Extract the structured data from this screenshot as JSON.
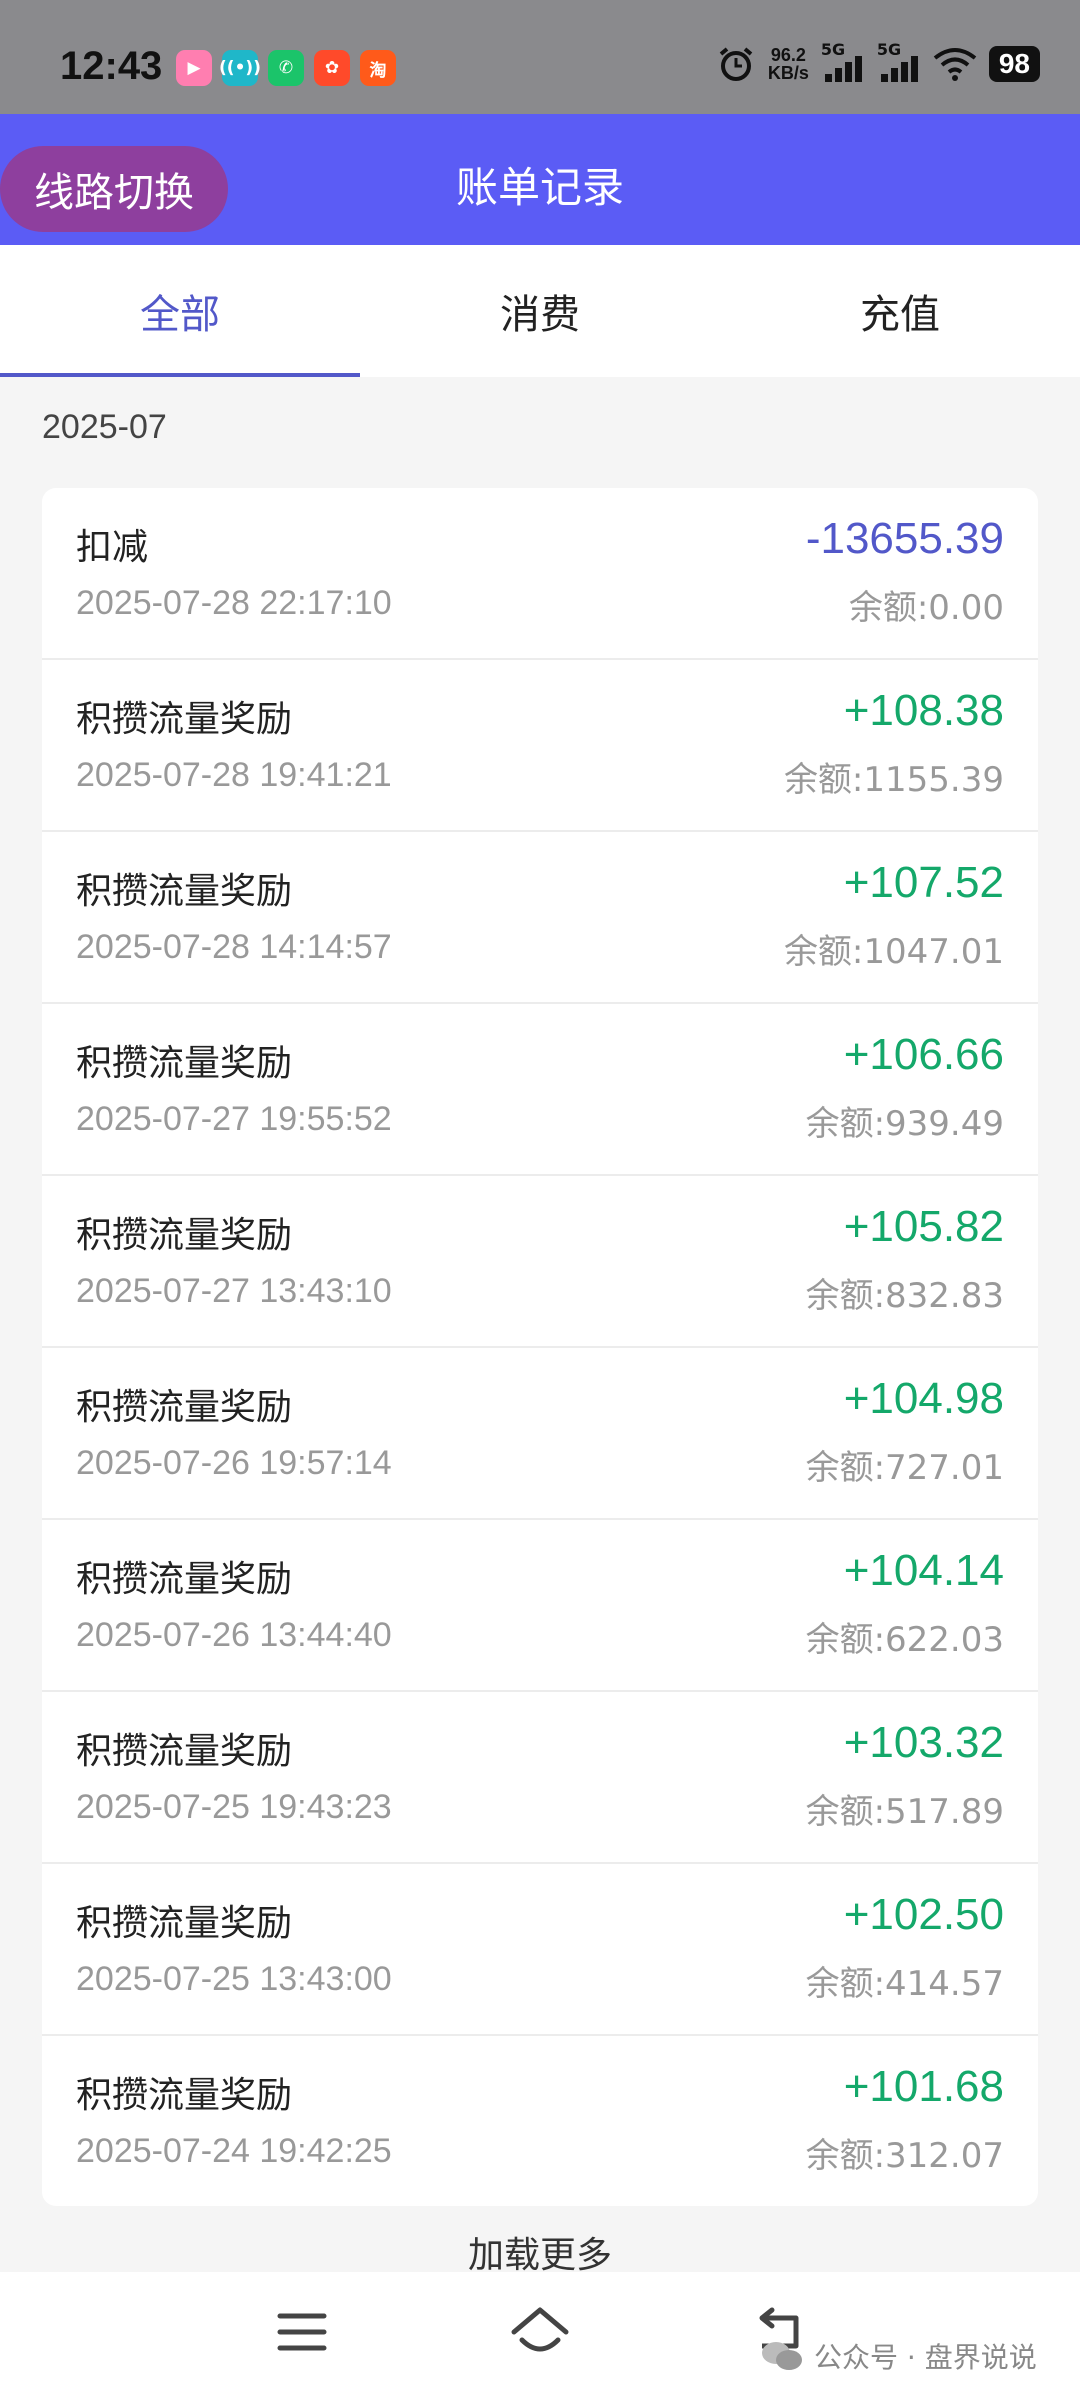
{
  "status_bar": {
    "time": "12:43",
    "net_speed_value": "96.2",
    "net_speed_unit": "KB/s",
    "sim1_label": "5G",
    "sim2_label": "5G",
    "battery": "98"
  },
  "header": {
    "route_button": "线路切换",
    "title": "账单记录"
  },
  "tabs": [
    {
      "label": "全部",
      "active": true
    },
    {
      "label": "消费",
      "active": false
    },
    {
      "label": "充值",
      "active": false
    }
  ],
  "month": "2025-07",
  "transactions": [
    {
      "title": "扣减",
      "time": "2025-07-28 22:17:10",
      "amount": "-13655.39",
      "balance": "余额:0.00"
    },
    {
      "title": "积攒流量奖励",
      "time": "2025-07-28 19:41:21",
      "amount": "+108.38",
      "balance": "余额:1155.39"
    },
    {
      "title": "积攒流量奖励",
      "time": "2025-07-28 14:14:57",
      "amount": "+107.52",
      "balance": "余额:1047.01"
    },
    {
      "title": "积攒流量奖励",
      "time": "2025-07-27 19:55:52",
      "amount": "+106.66",
      "balance": "余额:939.49"
    },
    {
      "title": "积攒流量奖励",
      "time": "2025-07-27 13:43:10",
      "amount": "+105.82",
      "balance": "余额:832.83"
    },
    {
      "title": "积攒流量奖励",
      "time": "2025-07-26 19:57:14",
      "amount": "+104.98",
      "balance": "余额:727.01"
    },
    {
      "title": "积攒流量奖励",
      "time": "2025-07-26 13:44:40",
      "amount": "+104.14",
      "balance": "余额:622.03"
    },
    {
      "title": "积攒流量奖励",
      "time": "2025-07-25 19:43:23",
      "amount": "+103.32",
      "balance": "余额:517.89"
    },
    {
      "title": "积攒流量奖励",
      "time": "2025-07-25 13:43:00",
      "amount": "+102.50",
      "balance": "余额:414.57"
    },
    {
      "title": "积攒流量奖励",
      "time": "2025-07-24 19:42:25",
      "amount": "+101.68",
      "balance": "余额:312.07"
    }
  ],
  "load_more": "加载更多",
  "watermark": "公众号 · 盘界说说",
  "colors": {
    "header_bg": "#5b5cf5",
    "route_button_bg": "#8e3f9e",
    "accent": "#5258c9",
    "positive": "#14a86a"
  },
  "icons": {
    "nav_menu": "menu-icon",
    "nav_home": "home-icon",
    "nav_back": "back-icon",
    "alarm": "alarm-icon",
    "wifi": "wifi-icon"
  }
}
